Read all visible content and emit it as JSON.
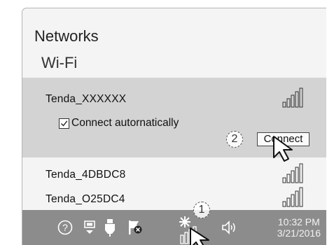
{
  "flyout": {
    "title": "Networks",
    "section": "Wi-Fi",
    "selected_network": {
      "name": "Tenda_XXXXXX",
      "auto_connect_label": "Connect autornatically",
      "auto_connect_checked": true,
      "connect_label": "Connect"
    },
    "networks": [
      {
        "name": "Tenda_4DBDC8"
      },
      {
        "name": "Tenda_O25DC4"
      }
    ]
  },
  "annotations": {
    "step1": "1",
    "step2": "2"
  },
  "taskbar": {
    "icons": [
      "help-icon",
      "windows-update-icon",
      "usb-device-icon",
      "action-center-flag-icon",
      "wifi-icon",
      "volume-icon"
    ],
    "time": "10:32 PM",
    "date": "3/21/2016"
  },
  "colors": {
    "panel_bg": "#f4f4f4",
    "selected_bg": "#d3d3d3",
    "taskbar_bg": "#8c8c8c"
  }
}
